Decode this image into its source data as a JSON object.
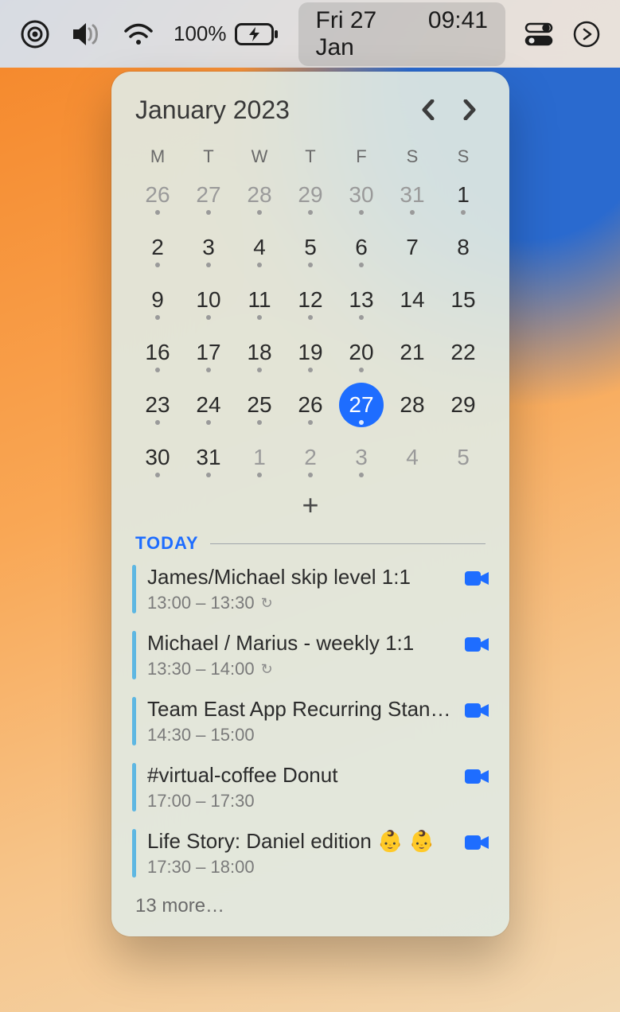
{
  "menubar": {
    "battery_pct": "100%",
    "date": "Fri 27 Jan",
    "time": "09:41"
  },
  "calendar": {
    "month_title": "January 2023",
    "weekdays": [
      "M",
      "T",
      "W",
      "T",
      "F",
      "S",
      "S"
    ],
    "days": [
      {
        "n": "26",
        "dim": true,
        "dot": true
      },
      {
        "n": "27",
        "dim": true,
        "dot": true
      },
      {
        "n": "28",
        "dim": true,
        "dot": true
      },
      {
        "n": "29",
        "dim": true,
        "dot": true
      },
      {
        "n": "30",
        "dim": true,
        "dot": true
      },
      {
        "n": "31",
        "dim": true,
        "dot": true
      },
      {
        "n": "1",
        "dot": true
      },
      {
        "n": "2",
        "dot": true
      },
      {
        "n": "3",
        "dot": true
      },
      {
        "n": "4",
        "dot": true
      },
      {
        "n": "5",
        "dot": true
      },
      {
        "n": "6",
        "dot": true
      },
      {
        "n": "7"
      },
      {
        "n": "8"
      },
      {
        "n": "9",
        "dot": true
      },
      {
        "n": "10",
        "dot": true
      },
      {
        "n": "11",
        "dot": true
      },
      {
        "n": "12",
        "dot": true
      },
      {
        "n": "13",
        "dot": true
      },
      {
        "n": "14"
      },
      {
        "n": "15"
      },
      {
        "n": "16",
        "dot": true
      },
      {
        "n": "17",
        "dot": true
      },
      {
        "n": "18",
        "dot": true
      },
      {
        "n": "19",
        "dot": true
      },
      {
        "n": "20",
        "dot": true
      },
      {
        "n": "21"
      },
      {
        "n": "22"
      },
      {
        "n": "23",
        "dot": true
      },
      {
        "n": "24",
        "dot": true
      },
      {
        "n": "25",
        "dot": true
      },
      {
        "n": "26",
        "dot": true
      },
      {
        "n": "27",
        "dot": true,
        "today": true
      },
      {
        "n": "28"
      },
      {
        "n": "29"
      },
      {
        "n": "30",
        "dot": true
      },
      {
        "n": "31",
        "dot": true
      },
      {
        "n": "1",
        "dim": true,
        "dot": true
      },
      {
        "n": "2",
        "dim": true,
        "dot": true
      },
      {
        "n": "3",
        "dim": true,
        "dot": true
      },
      {
        "n": "4",
        "dim": true
      },
      {
        "n": "5",
        "dim": true
      }
    ]
  },
  "today_section": {
    "label": "TODAY",
    "more": "13 more…"
  },
  "events": [
    {
      "title": "James/Michael skip level 1:1",
      "time": "13:00 – 13:30",
      "recurring": true,
      "video": true,
      "color": "#5eb7e2"
    },
    {
      "title": "Michael / Marius - weekly 1:1",
      "time": "13:30 – 14:00",
      "recurring": true,
      "video": true,
      "color": "#5eb7e2"
    },
    {
      "title": "Team East App Recurring Stan…",
      "time": "14:30 – 15:00",
      "recurring": false,
      "video": true,
      "color": "#5eb7e2"
    },
    {
      "title": "#virtual-coffee Donut",
      "time": "17:00 – 17:30",
      "recurring": false,
      "video": true,
      "color": "#5eb7e2"
    },
    {
      "title": "Life Story: Daniel edition 👶 👶",
      "time": "17:30 – 18:00",
      "recurring": false,
      "video": true,
      "color": "#5eb7e2"
    }
  ]
}
